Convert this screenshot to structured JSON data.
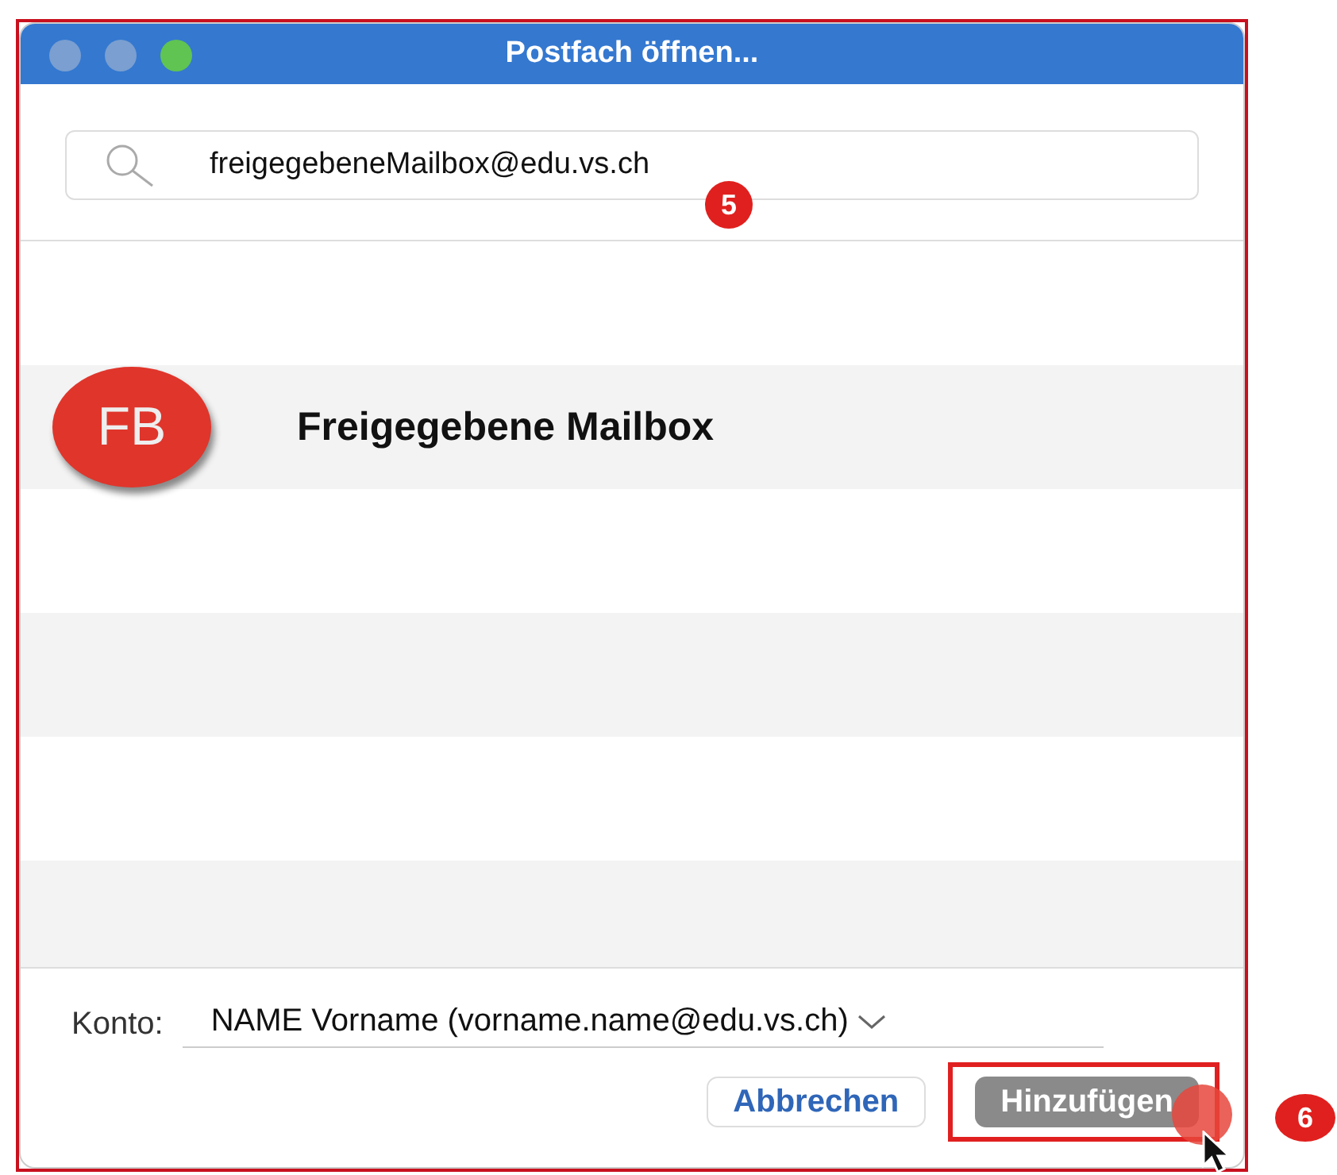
{
  "window": {
    "title": "Postfach öffnen..."
  },
  "search": {
    "value": "freigegebeneMailbox@edu.vs.ch"
  },
  "results": [
    {
      "initials": "FB",
      "name": "Freigegebene Mailbox"
    }
  ],
  "account": {
    "label": "Konto:",
    "value": "NAME Vorname (vorname.name@edu.vs.ch)"
  },
  "buttons": [
    {
      "label": "Abbrechen",
      "kind": "secondary"
    },
    {
      "label": "Hinzufügen",
      "kind": "primary"
    }
  ],
  "annotations": [
    {
      "text": "5"
    },
    {
      "text": "6"
    }
  ]
}
